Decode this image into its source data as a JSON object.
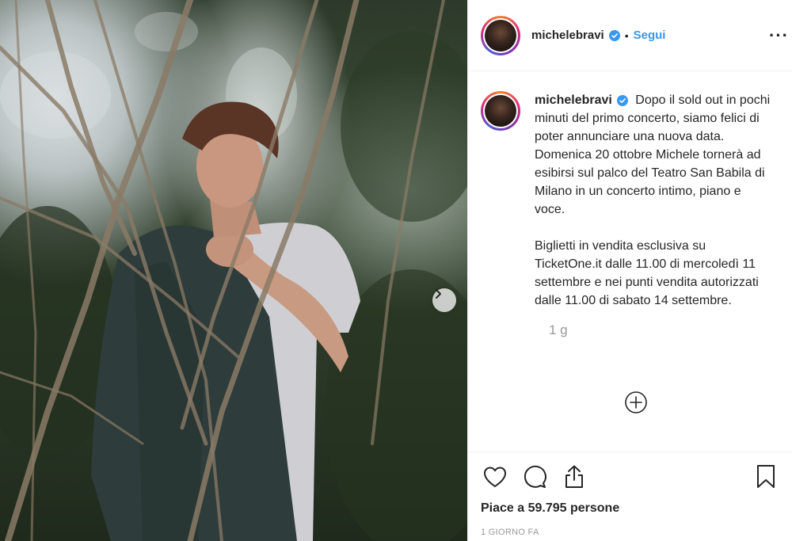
{
  "post": {
    "username": "michelebravi",
    "separator": "•",
    "follow_label": "Segui",
    "more_label": "···",
    "caption": {
      "paragraph1": "Dopo il sold out in pochi minuti del primo concerto, siamo felici di poter annunciare una nuova data.",
      "paragraph1b": "Domenica 20 ottobre Michele tornerà ad esibirsi sul palco del Teatro San Babila di Milano in un concerto intimo, piano e voce.",
      "paragraph2": "Biglietti in vendita esclusiva su TicketOne.it dalle 11.00 di mercoledì 11 settembre e nei punti vendita autorizzati dalle 11.00 di sabato 14 settembre."
    },
    "caption_time": "1 g",
    "likes_text": "Piace a 59.795 persone",
    "date_text": "1 GIORNO FA"
  },
  "icons": {
    "verified": "verified-badge-icon",
    "next": "chevron-right-icon",
    "load_more": "plus-circle-icon",
    "like": "heart-icon",
    "comment": "comment-icon",
    "share": "share-icon",
    "save": "bookmark-icon"
  },
  "colors": {
    "link": "#3897f0",
    "verified": "#3897f0",
    "muted": "#999999",
    "text": "#262626"
  }
}
